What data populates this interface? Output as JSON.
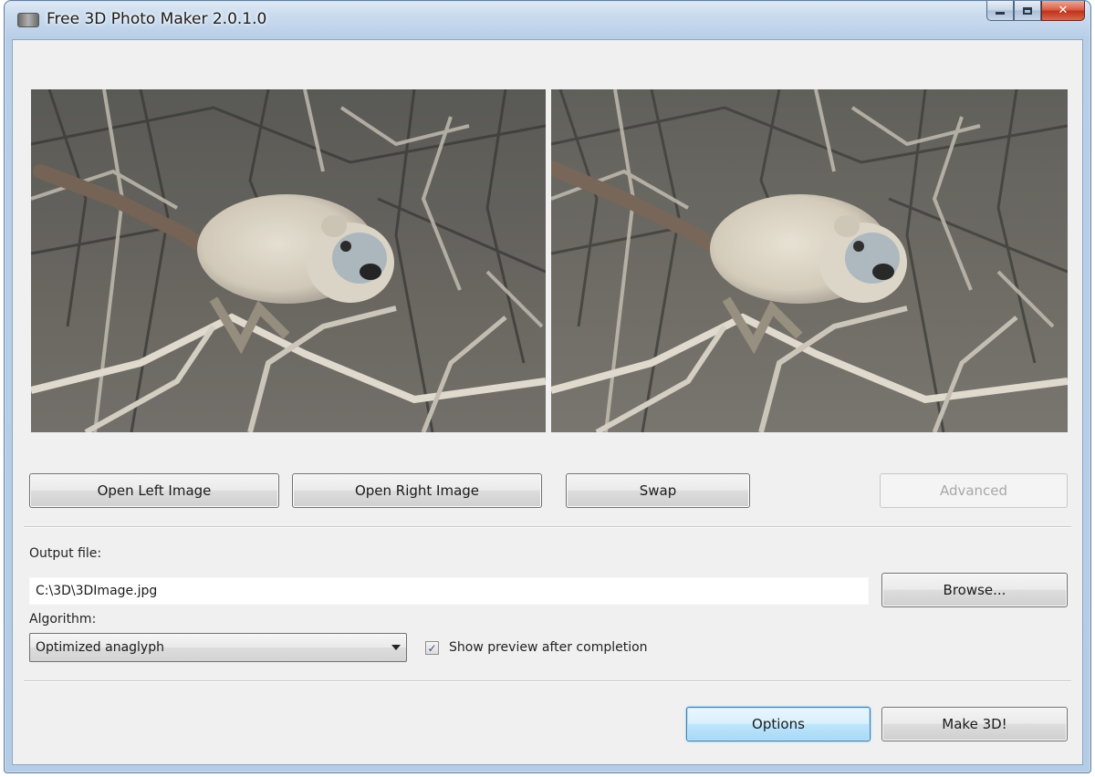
{
  "window": {
    "title": "Free 3D Photo Maker 2.0.1.0"
  },
  "caption_buttons": {
    "close_glyph": "✕"
  },
  "images": {
    "left": "left-preview-photo",
    "right": "right-preview-photo"
  },
  "buttons": {
    "open_left": "Open Left Image",
    "open_right": "Open Right Image",
    "swap": "Swap",
    "advanced": "Advanced",
    "browse": "Browse...",
    "options": "Options",
    "make_3d": "Make 3D!"
  },
  "output": {
    "label": "Output file:",
    "value": "C:\\3D\\3DImage.jpg"
  },
  "algorithm": {
    "label": "Algorithm:",
    "selected": "Optimized anaglyph"
  },
  "preview_checkbox": {
    "label": "Show preview after completion",
    "checked": true,
    "check_glyph": "✓"
  },
  "colors": {
    "accent": "#3c7fb1",
    "close_button": "#c0321a"
  }
}
